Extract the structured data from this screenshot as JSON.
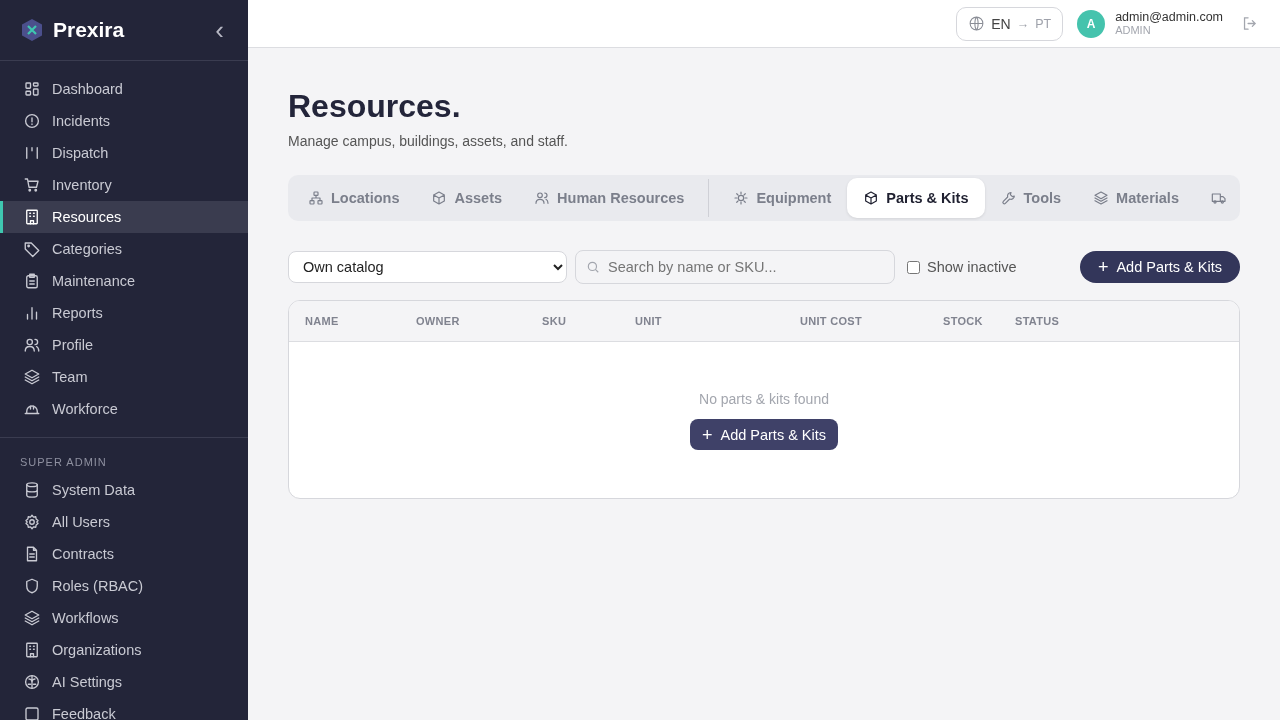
{
  "sidebar": {
    "brand": "Prexira",
    "collapse_glyph": "‹",
    "items": [
      {
        "label": "Dashboard",
        "selected": false
      },
      {
        "label": "Incidents",
        "selected": false
      },
      {
        "label": "Dispatch",
        "selected": false
      },
      {
        "label": "Inventory",
        "selected": false
      },
      {
        "label": "Resources",
        "selected": true
      },
      {
        "label": "Categories",
        "selected": false
      },
      {
        "label": "Maintenance",
        "selected": false
      },
      {
        "label": "Reports",
        "selected": false
      },
      {
        "label": "Profile",
        "selected": false
      },
      {
        "label": "Team",
        "selected": false
      },
      {
        "label": "Workforce",
        "selected": false
      }
    ],
    "section_title": "SUPER ADMIN",
    "admin_items": [
      {
        "label": "System Data",
        "selected": false
      },
      {
        "label": "All Users",
        "selected": false
      },
      {
        "label": "Contracts",
        "selected": false
      },
      {
        "label": "Roles (RBAC)",
        "selected": false
      },
      {
        "label": "Workflows",
        "selected": false
      },
      {
        "label": "Organizations",
        "selected": false
      },
      {
        "label": "AI Settings",
        "selected": false
      },
      {
        "label": "Feedback",
        "selected": false
      }
    ]
  },
  "header": {
    "language": {
      "options": [
        {
          "label": "EN",
          "selected": true
        },
        {
          "label": "PT",
          "selected": false
        }
      ],
      "arrow": "→"
    },
    "user": {
      "avatar": "A",
      "email": "admin@admin.com",
      "role": "ADMIN"
    }
  },
  "page": {
    "title": "Resources.",
    "subtitle": "Manage campus, buildings, assets, and staff."
  },
  "tabs": [
    {
      "label": "Locations",
      "selected": false
    },
    {
      "label": "Assets",
      "selected": false
    },
    {
      "label": "Human Resources",
      "selected": false
    },
    {
      "label": "Equipment",
      "selected": false
    },
    {
      "label": "Parts & Kits",
      "selected": true
    },
    {
      "label": "Tools",
      "selected": false
    },
    {
      "label": "Materials",
      "selected": false
    },
    {
      "selected": false
    }
  ],
  "toolbar": {
    "catalog": {
      "value": "Own catalog"
    },
    "search": {
      "placeholder": "Search by name or SKU..."
    },
    "show_inactive": {
      "label": "Show inactive",
      "checked": false
    },
    "add_button": {
      "glyph": "+",
      "label": "Add Parts & Kits"
    }
  },
  "table": {
    "columns": [
      "NAME",
      "OWNER",
      "SKU",
      "UNIT",
      "UNIT COST",
      "STOCK",
      "STATUS"
    ],
    "empty_message": "No parts & kits found",
    "empty_button": {
      "glyph": "+",
      "label": "Add Parts & Kits"
    }
  }
}
